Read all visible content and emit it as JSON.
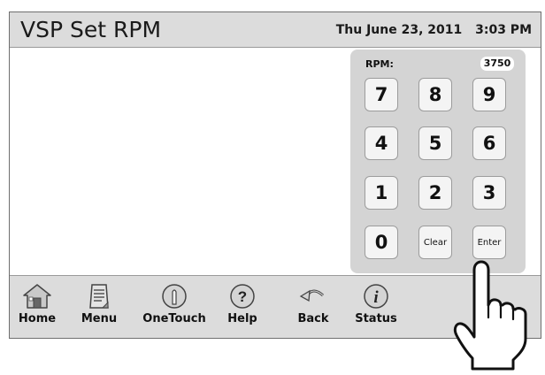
{
  "header": {
    "title": "VSP Set RPM",
    "date": "Thu June 23, 2011",
    "time": "3:03 PM"
  },
  "keypad": {
    "rpm_label": "RPM:",
    "rpm_value": "3750",
    "keys": [
      "7",
      "8",
      "9",
      "4",
      "5",
      "6",
      "1",
      "2",
      "3",
      "0",
      "Clear",
      "Enter"
    ]
  },
  "nav": {
    "home": "Home",
    "menu": "Menu",
    "onetouch": "OneTouch",
    "help": "Help",
    "back": "Back",
    "status": "Status"
  },
  "icons": {
    "home": "house-icon",
    "menu": "document-icon",
    "onetouch": "touch-icon",
    "help": "question-icon",
    "back": "back-arrow-icon",
    "status": "info-icon",
    "pointer": "pointing-hand-icon"
  }
}
